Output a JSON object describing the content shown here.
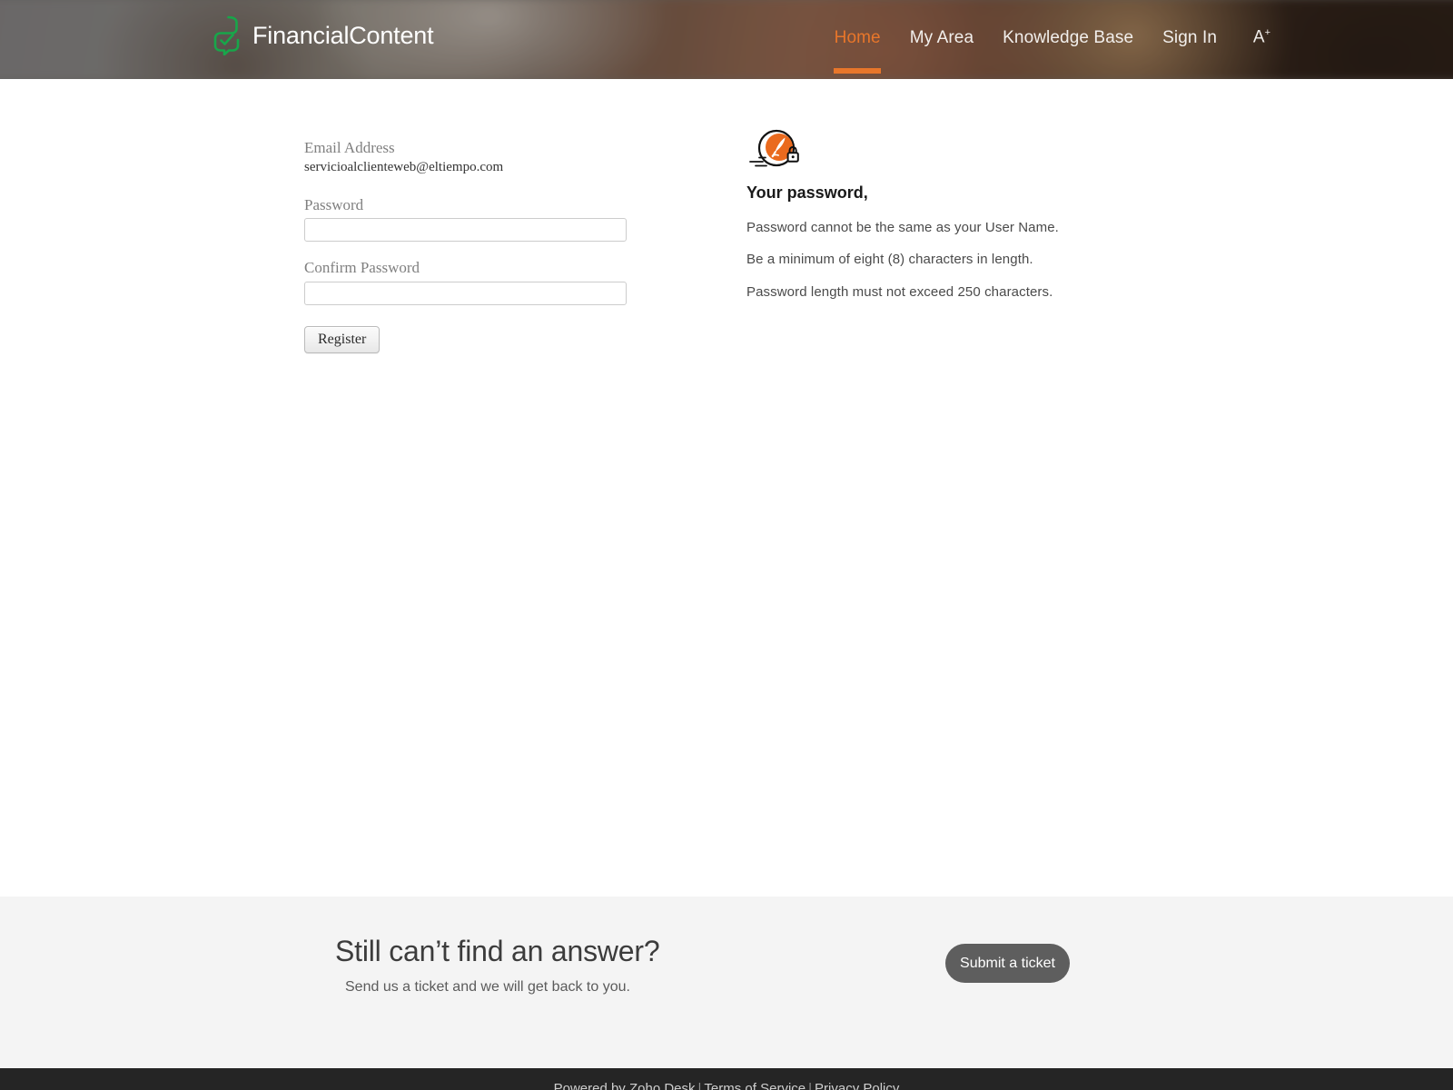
{
  "header": {
    "brand_name": "FinancialContent",
    "brand_logo_icon": "speech-bubble-check-logo",
    "nav": [
      {
        "label": "Home",
        "active": true
      },
      {
        "label": "My Area",
        "active": false
      },
      {
        "label": "Knowledge Base",
        "active": false
      },
      {
        "label": "Sign In",
        "active": false
      }
    ],
    "font_size_toggle": {
      "letter": "A",
      "superscript": "+",
      "icon": "font-size-increase-icon"
    },
    "accent_color": "#e8762a",
    "nav_text_color": "#f2efec"
  },
  "form": {
    "email_label": "Email Address",
    "email_value": "servicioalclienteweb@eltiempo.com",
    "password_label": "Password",
    "password_value": "",
    "password_placeholder": "",
    "confirm_password_label": "Confirm Password",
    "confirm_password_value": "",
    "confirm_password_placeholder": "",
    "register_button_label": "Register"
  },
  "rules": {
    "icon": "password-quill-lock-icon",
    "icon_color": "#ea6a1e",
    "title": "Your password,",
    "items": [
      "Password cannot be the same as your User Name.",
      "Be a minimum of eight (8) characters in length.",
      "Password length must not exceed 250 characters."
    ]
  },
  "cta": {
    "heading": "Still can’t find an answer?",
    "subtext": "Send us a ticket and we will get back to you.",
    "button_label": "Submit a ticket",
    "background_color": "#f4f4f4",
    "button_color": "#5e5e5e"
  },
  "bottom_bar": {
    "powered_by": "Powered by Zoho Desk",
    "separator": "|",
    "terms_label": "Terms of Service",
    "privacy_label": "Privacy Policy",
    "background_color": "#252525"
  }
}
